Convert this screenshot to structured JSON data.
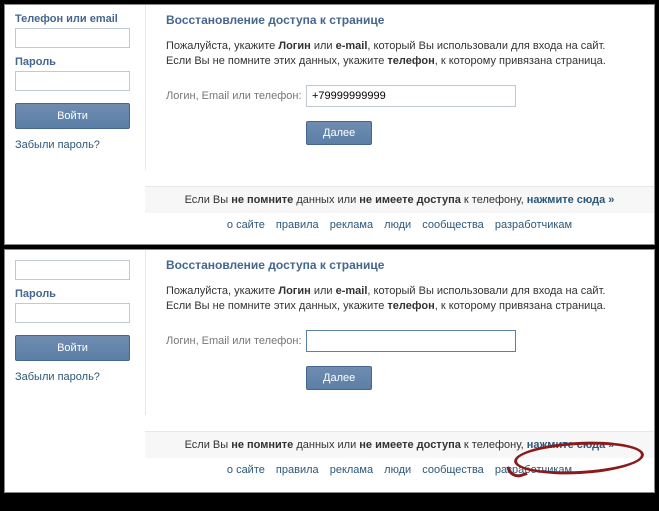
{
  "sidebar": {
    "email_label": "Телефон или email",
    "password_label": "Пароль",
    "login_button": "Войти",
    "forgot_link": "Забыли пароль?"
  },
  "main": {
    "title": "Восстановление доступа к странице",
    "instruction1_prefix": "Пожалуйста, укажите ",
    "instruction1_login": "Логин",
    "instruction1_or": " или ",
    "instruction1_email": "e-mail",
    "instruction1_suffix": ", который Вы использовали для входа на сайт.",
    "instruction2_prefix": "Если Вы не помните этих данных, укажите ",
    "instruction2_phone": "телефон",
    "instruction2_suffix": ", к которому привязана страница.",
    "field_label": "Логин, Email или телефон:",
    "field_value_top": "+79999999999",
    "field_value_bottom": "",
    "next_button": "Далее"
  },
  "footer_bar": {
    "prefix": "Если Вы ",
    "no_remember": "не помните",
    "mid1": " данных или ",
    "no_access": "не имеете доступа",
    "mid2": " к телефону, ",
    "click_here": "нажмите сюда »"
  },
  "footer_links": {
    "about": "о сайте",
    "rules": "правила",
    "ads": "реклама",
    "people": "люди",
    "groups": "сообщества",
    "devs": "разработчикам"
  }
}
